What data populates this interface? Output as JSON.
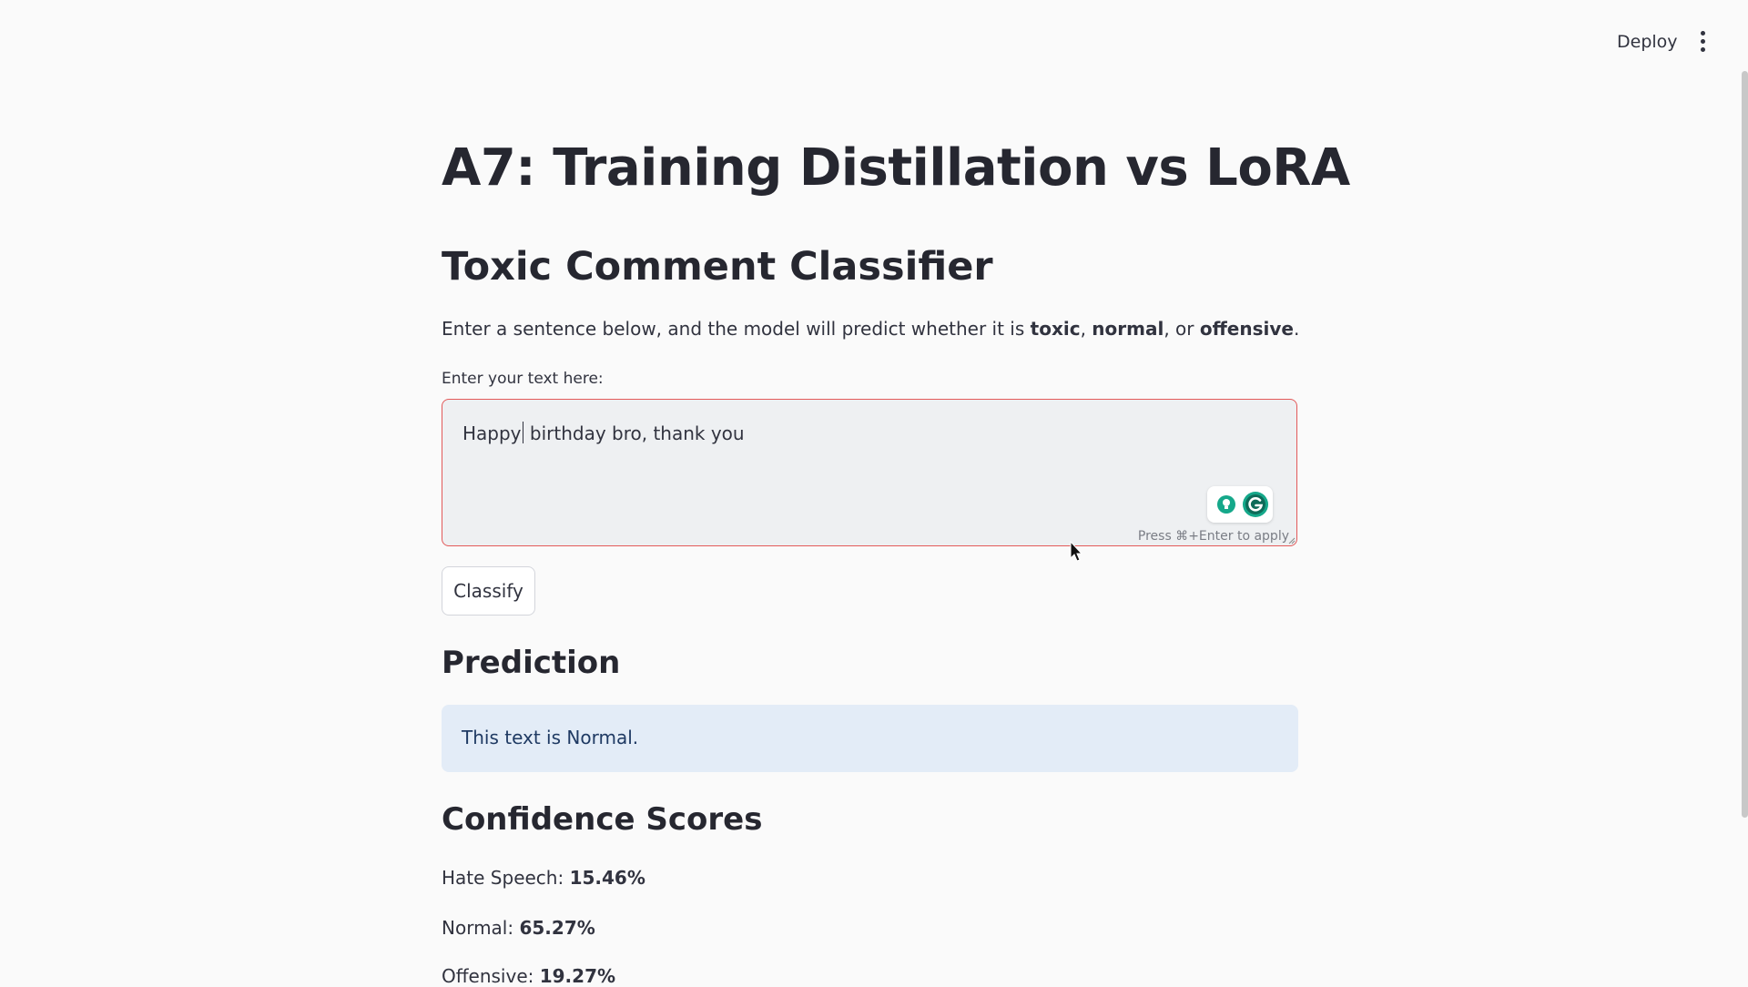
{
  "header": {
    "deploy_label": "Deploy",
    "menu_icon": "vertical-ellipsis-icon"
  },
  "main": {
    "title": "A7: Training Distillation vs LoRA",
    "subtitle": "Toxic Comment Classifier",
    "description": {
      "prefix": "Enter a sentence below, and the model will predict whether it is ",
      "label_toxic": "toxic",
      "sep1": ", ",
      "label_normal": "normal",
      "sep2": ", or ",
      "label_offensive": "offensive",
      "suffix": "."
    },
    "input": {
      "label": "Enter your text here:",
      "value_before_caret": "Happy",
      "value_after_caret": " birthday bro, thank you",
      "hint": "Press ⌘+Enter to apply",
      "border_color": "#e35a5a"
    },
    "classify_label": "Classify",
    "prediction": {
      "heading": "Prediction",
      "message": "This text is Normal.",
      "box_color": "#e3ecf7"
    },
    "confidence": {
      "heading": "Confidence Scores",
      "scores": [
        {
          "label": "Hate Speech: ",
          "value": "15.46%"
        },
        {
          "label": "Normal: ",
          "value": "65.27%"
        },
        {
          "label": "Offensive: ",
          "value": "19.27%"
        }
      ]
    }
  }
}
